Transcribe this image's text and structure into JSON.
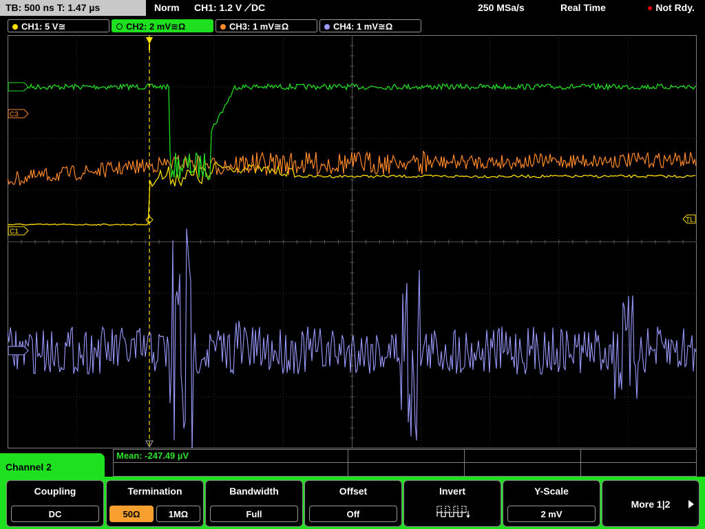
{
  "topbar": {
    "timebase": "TB: 500 ns   T: 1.47 µs",
    "mode": "Norm",
    "trigger": "CH1: 1.2 V ⟋DC",
    "samplerate": "250 MSa/s",
    "acq": "Real Time",
    "status": "Not Rdy."
  },
  "channels": [
    {
      "label": "CH1: 5 V≅",
      "color": "#ffe100"
    },
    {
      "label": "CH2: 2 mV≅Ω",
      "color": "#22dd22"
    },
    {
      "label": "CH3: 1 mV≅Ω",
      "color": "#ff8a2a"
    },
    {
      "label": "CH4: 1 mV≅Ω",
      "color": "#9b9bff"
    }
  ],
  "markers": {
    "c1": "C1",
    "c3": "C3",
    "tl": "TL"
  },
  "measurement": "Mean: -247.49 µV",
  "menu": {
    "title": "Channel 2",
    "coupling": {
      "label": "Coupling",
      "value": "DC"
    },
    "termination": {
      "label": "Termination",
      "opt1": "50Ω",
      "opt2": "1MΩ"
    },
    "bandwidth": {
      "label": "Bandwidth",
      "value": "Full"
    },
    "offset": {
      "label": "Offset",
      "value": "Off"
    },
    "invert": {
      "label": "Invert"
    },
    "yscale": {
      "label": "Y-Scale",
      "value": "2 mV"
    },
    "more": {
      "label": "More 1|2"
    }
  }
}
